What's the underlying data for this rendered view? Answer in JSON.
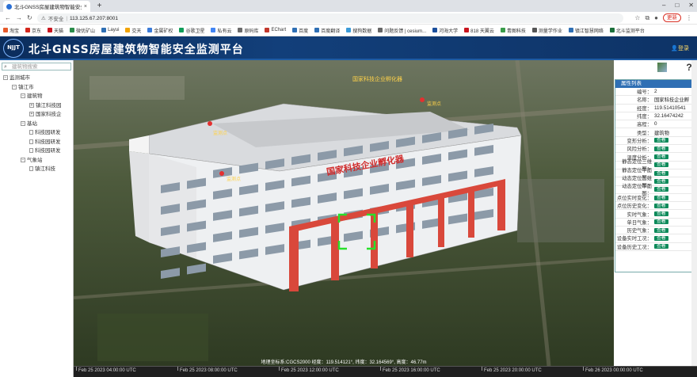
{
  "browser": {
    "tab_title": "北斗GNSS房屋建筑物智能安全监...",
    "tab_close": "×",
    "new_tab": "+",
    "security": "不安全",
    "url": "113.125.67.207:8001",
    "update_label": "更新"
  },
  "bookmarks": [
    "淘宝",
    "京东",
    "天猫",
    "微优矿山",
    "Layui",
    "交天",
    "金属矿权",
    "谷歌卫星",
    "私有云",
    "原码库",
    "EChart",
    "百度",
    "百度翻译",
    "搜狗数据",
    "问题反馈 | cesium...",
    "河海大学",
    "818 天翼云",
    "青图科技",
    "测量学作业",
    "镇江智慧网络",
    "北斗监测平台"
  ],
  "app": {
    "title": "北斗GNSS房屋建筑物智能安全监测平台",
    "logo_text": "NJJT",
    "login": "登录"
  },
  "sidebar": {
    "search_placeholder": "建筑物搜索",
    "tree": [
      {
        "label": "监测城市",
        "level": 0,
        "kind": "folder",
        "toggle": "−"
      },
      {
        "label": "镇江市",
        "level": 1,
        "kind": "folder",
        "toggle": "−"
      },
      {
        "label": "建筑物",
        "level": 2,
        "kind": "folder",
        "toggle": "−"
      },
      {
        "label": "镇江科技园",
        "level": 3,
        "kind": "folder",
        "toggle": "+"
      },
      {
        "label": "国家科技企",
        "level": 3,
        "kind": "folder",
        "toggle": "+"
      },
      {
        "label": "基站",
        "level": 2,
        "kind": "folder",
        "toggle": "−"
      },
      {
        "label": "科技园研发",
        "level": 3,
        "kind": "leaf"
      },
      {
        "label": "科技园研发",
        "level": 3,
        "kind": "leaf"
      },
      {
        "label": "科技园研发",
        "level": 3,
        "kind": "leaf"
      },
      {
        "label": "气象站",
        "level": 2,
        "kind": "folder",
        "toggle": "−"
      },
      {
        "label": "镇江科技",
        "level": 3,
        "kind": "leaf"
      }
    ]
  },
  "scene": {
    "building_sign": "国家科技企业孵化器",
    "top_label": "国家科技企业孵化器",
    "marker_labels": [
      "监测点",
      "监测点",
      "监测点"
    ]
  },
  "properties": {
    "header": "属性列表",
    "rows": [
      {
        "key": "编号：",
        "value": "2"
      },
      {
        "key": "名称：",
        "value": "国家科技企业孵"
      },
      {
        "key": "经度：",
        "value": "119.51410541"
      },
      {
        "key": "纬度：",
        "value": "32.16474242"
      },
      {
        "key": "高程：",
        "value": "0"
      },
      {
        "key": "类型：",
        "value": "建筑物"
      },
      {
        "key": "变形分析：",
        "button": "查看"
      },
      {
        "key": "风险分析：",
        "button": "查看"
      },
      {
        "key": "温度分析：",
        "button": "查看"
      },
      {
        "key": "静态定位三维图：",
        "button": "查看"
      },
      {
        "key": "静态定位平面图：",
        "button": "查看"
      },
      {
        "key": "动态定位三维图：",
        "button": "查看"
      },
      {
        "key": "动态定位平面图：",
        "button": "查看"
      },
      {
        "key": "点位实时变化：",
        "button": "查看"
      },
      {
        "key": "点位历史变化：",
        "button": "查看"
      },
      {
        "key": "实时气象：",
        "button": "查看"
      },
      {
        "key": "单日气象：",
        "button": "查看"
      },
      {
        "key": "历史气象：",
        "button": "查看"
      },
      {
        "key": "设备实时工况：",
        "button": "查看"
      },
      {
        "key": "设备历史工况：",
        "button": "查看"
      }
    ]
  },
  "status": {
    "coord_text": "地理坐标系:CGCS2000 经度：119.514121°, 纬度：32.164569°, 高度：46.77m"
  },
  "timeline": [
    "Feb 25 2023 04:00:00 UTC",
    "Feb 25 2023 08:00:00 UTC",
    "Feb 25 2023 12:00:00 UTC",
    "Feb 25 2023 16:00:00 UTC",
    "Feb 25 2023 20:00:00 UTC",
    "Feb 26 2023 00:00:00 UTC"
  ],
  "colors": {
    "header_bg": "#0e3366",
    "panel_header": "#2f6fb4",
    "view_button": "#0c8a5a",
    "accent_red": "#d9483b"
  },
  "icons": [
    "search-icon",
    "home-icon",
    "globe-icon",
    "basemap-icon",
    "info-icon",
    "help-icon"
  ]
}
